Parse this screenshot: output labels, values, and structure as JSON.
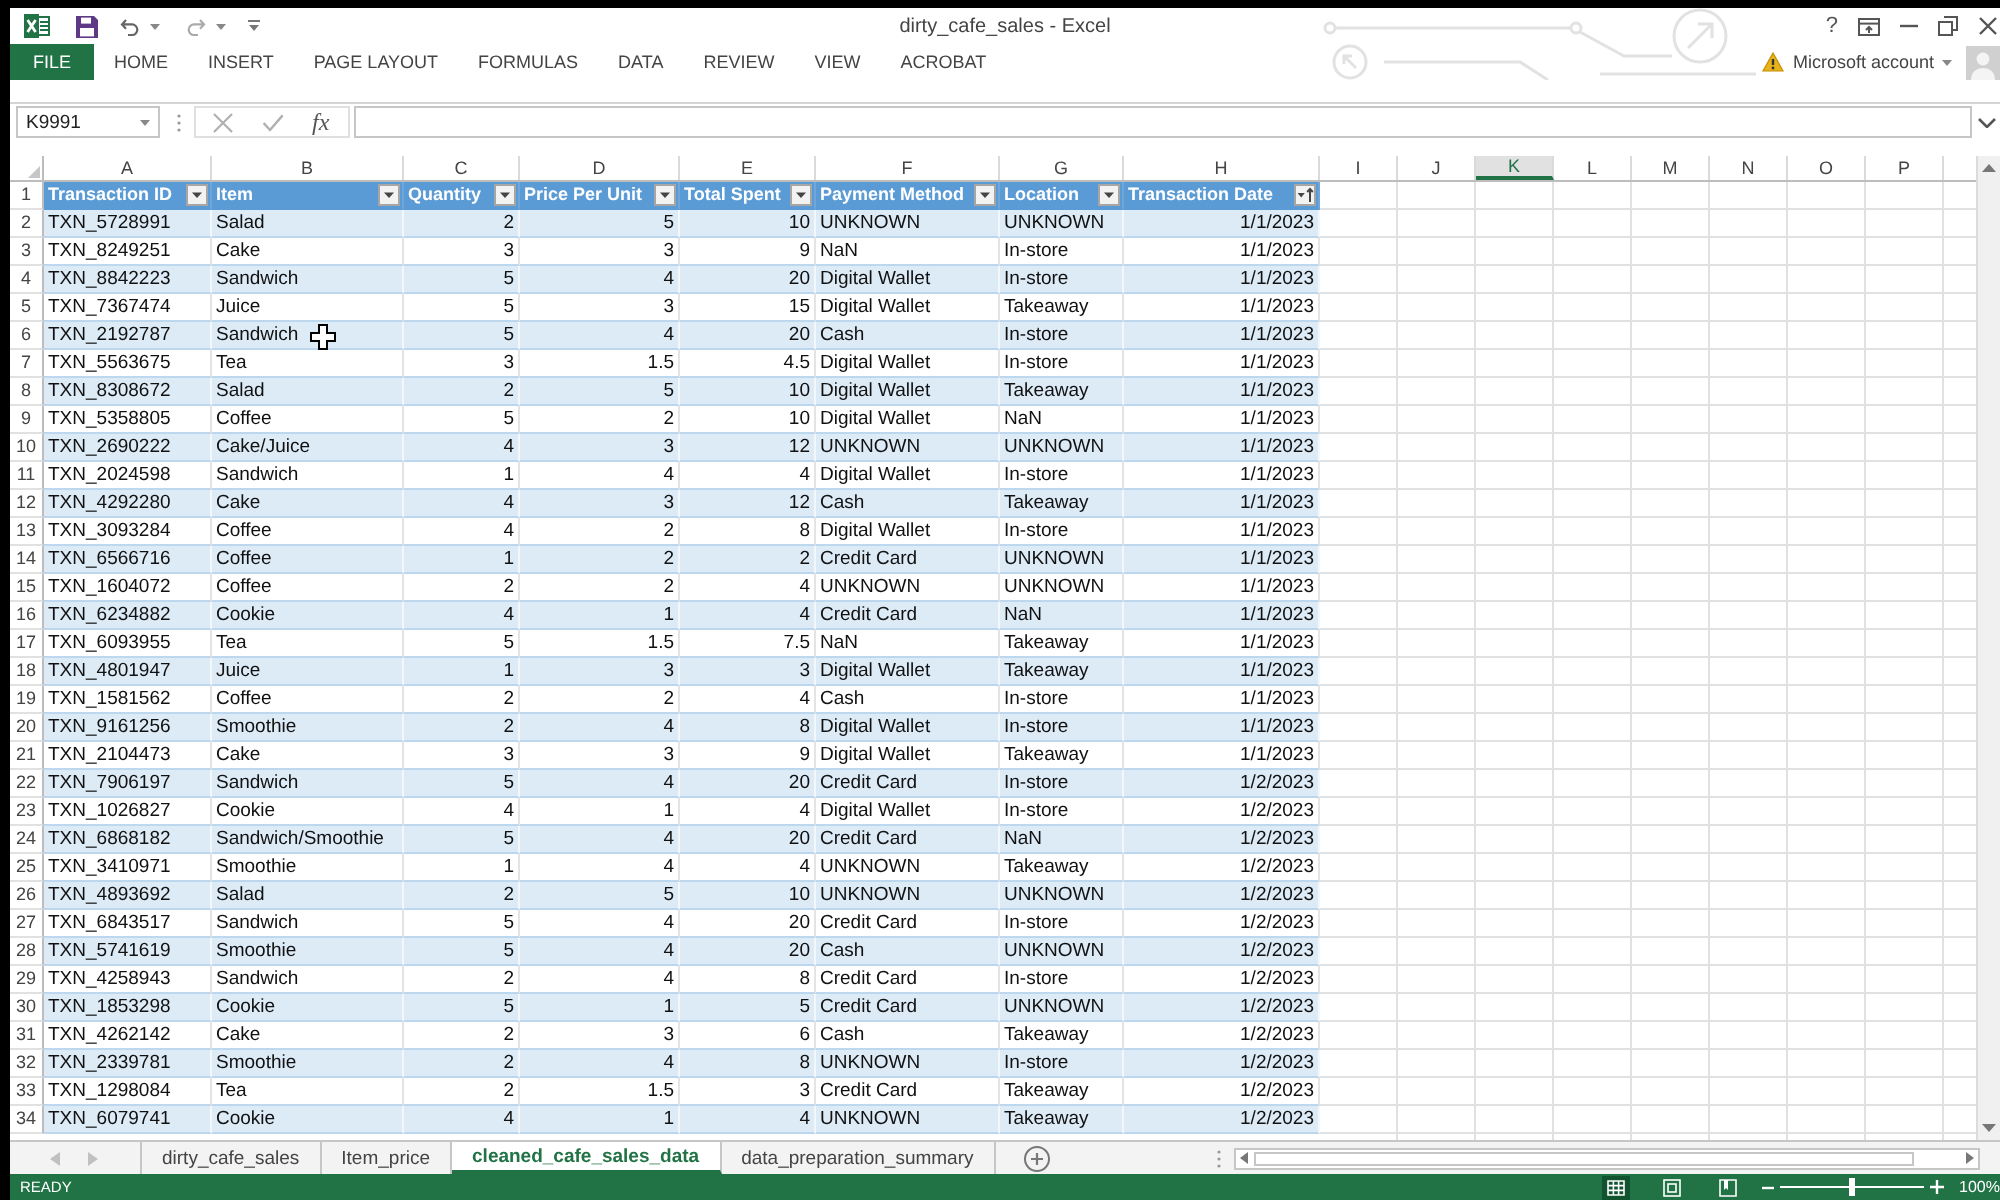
{
  "title_bar": {
    "title": "dirty_cafe_sales - Excel",
    "help": "?"
  },
  "ribbon": {
    "tabs": [
      {
        "label": "FILE",
        "kind": "backstage"
      },
      {
        "label": "HOME",
        "kind": "tab"
      },
      {
        "label": "INSERT",
        "kind": "tab"
      },
      {
        "label": "PAGE LAYOUT",
        "kind": "tab"
      },
      {
        "label": "FORMULAS",
        "kind": "tab"
      },
      {
        "label": "DATA",
        "kind": "tab"
      },
      {
        "label": "REVIEW",
        "kind": "tab"
      },
      {
        "label": "VIEW",
        "kind": "tab"
      },
      {
        "label": "ACROBAT",
        "kind": "tab"
      }
    ],
    "account": "Microsoft account"
  },
  "formula_bar": {
    "name_box": "K9991",
    "function_label": "fx"
  },
  "column_letters": [
    {
      "letter": "A",
      "selected": false
    },
    {
      "letter": "B",
      "selected": false
    },
    {
      "letter": "C",
      "selected": false
    },
    {
      "letter": "D",
      "selected": false
    },
    {
      "letter": "E",
      "selected": false
    },
    {
      "letter": "F",
      "selected": false
    },
    {
      "letter": "G",
      "selected": false
    },
    {
      "letter": "H",
      "selected": false
    },
    {
      "letter": "I",
      "selected": false
    },
    {
      "letter": "J",
      "selected": false
    },
    {
      "letter": "K",
      "selected": true
    },
    {
      "letter": "L",
      "selected": false
    },
    {
      "letter": "M",
      "selected": false
    },
    {
      "letter": "N",
      "selected": false
    },
    {
      "letter": "O",
      "selected": false
    },
    {
      "letter": "P",
      "selected": false
    }
  ],
  "table": {
    "header_row_number": "1",
    "columns": [
      {
        "name": "Transaction ID",
        "kind": "text",
        "sorted": false
      },
      {
        "name": "Item",
        "kind": "text",
        "sorted": false
      },
      {
        "name": "Quantity",
        "kind": "number",
        "sorted": false
      },
      {
        "name": "Price Per Unit",
        "kind": "number",
        "sorted": false
      },
      {
        "name": "Total Spent",
        "kind": "number",
        "sorted": false
      },
      {
        "name": "Payment Method",
        "kind": "text",
        "sorted": false
      },
      {
        "name": "Location",
        "kind": "text",
        "sorted": false
      },
      {
        "name": "Transaction Date",
        "kind": "date",
        "sorted": true
      }
    ],
    "rows": [
      {
        "number": "2",
        "cells": [
          "TXN_5728991",
          "Salad",
          "2",
          "5",
          "10",
          "UNKNOWN",
          "UNKNOWN",
          "1/1/2023"
        ]
      },
      {
        "number": "3",
        "cells": [
          "TXN_8249251",
          "Cake",
          "3",
          "3",
          "9",
          "NaN",
          "In-store",
          "1/1/2023"
        ]
      },
      {
        "number": "4",
        "cells": [
          "TXN_8842223",
          "Sandwich",
          "5",
          "4",
          "20",
          "Digital Wallet",
          "In-store",
          "1/1/2023"
        ]
      },
      {
        "number": "5",
        "cells": [
          "TXN_7367474",
          "Juice",
          "5",
          "3",
          "15",
          "Digital Wallet",
          "Takeaway",
          "1/1/2023"
        ]
      },
      {
        "number": "6",
        "cells": [
          "TXN_2192787",
          "Sandwich",
          "5",
          "4",
          "20",
          "Cash",
          "In-store",
          "1/1/2023"
        ]
      },
      {
        "number": "7",
        "cells": [
          "TXN_5563675",
          "Tea",
          "3",
          "1.5",
          "4.5",
          "Digital Wallet",
          "In-store",
          "1/1/2023"
        ]
      },
      {
        "number": "8",
        "cells": [
          "TXN_8308672",
          "Salad",
          "2",
          "5",
          "10",
          "Digital Wallet",
          "Takeaway",
          "1/1/2023"
        ]
      },
      {
        "number": "9",
        "cells": [
          "TXN_5358805",
          "Coffee",
          "5",
          "2",
          "10",
          "Digital Wallet",
          "NaN",
          "1/1/2023"
        ]
      },
      {
        "number": "10",
        "cells": [
          "TXN_2690222",
          "Cake/Juice",
          "4",
          "3",
          "12",
          "UNKNOWN",
          "UNKNOWN",
          "1/1/2023"
        ]
      },
      {
        "number": "11",
        "cells": [
          "TXN_2024598",
          "Sandwich",
          "1",
          "4",
          "4",
          "Digital Wallet",
          "In-store",
          "1/1/2023"
        ]
      },
      {
        "number": "12",
        "cells": [
          "TXN_4292280",
          "Cake",
          "4",
          "3",
          "12",
          "Cash",
          "Takeaway",
          "1/1/2023"
        ]
      },
      {
        "number": "13",
        "cells": [
          "TXN_3093284",
          "Coffee",
          "4",
          "2",
          "8",
          "Digital Wallet",
          "In-store",
          "1/1/2023"
        ]
      },
      {
        "number": "14",
        "cells": [
          "TXN_6566716",
          "Coffee",
          "1",
          "2",
          "2",
          "Credit Card",
          "UNKNOWN",
          "1/1/2023"
        ]
      },
      {
        "number": "15",
        "cells": [
          "TXN_1604072",
          "Coffee",
          "2",
          "2",
          "4",
          "UNKNOWN",
          "UNKNOWN",
          "1/1/2023"
        ]
      },
      {
        "number": "16",
        "cells": [
          "TXN_6234882",
          "Cookie",
          "4",
          "1",
          "4",
          "Credit Card",
          "NaN",
          "1/1/2023"
        ]
      },
      {
        "number": "17",
        "cells": [
          "TXN_6093955",
          "Tea",
          "5",
          "1.5",
          "7.5",
          "NaN",
          "Takeaway",
          "1/1/2023"
        ]
      },
      {
        "number": "18",
        "cells": [
          "TXN_4801947",
          "Juice",
          "1",
          "3",
          "3",
          "Digital Wallet",
          "Takeaway",
          "1/1/2023"
        ]
      },
      {
        "number": "19",
        "cells": [
          "TXN_1581562",
          "Coffee",
          "2",
          "2",
          "4",
          "Cash",
          "In-store",
          "1/1/2023"
        ]
      },
      {
        "number": "20",
        "cells": [
          "TXN_9161256",
          "Smoothie",
          "2",
          "4",
          "8",
          "Digital Wallet",
          "In-store",
          "1/1/2023"
        ]
      },
      {
        "number": "21",
        "cells": [
          "TXN_2104473",
          "Cake",
          "3",
          "3",
          "9",
          "Digital Wallet",
          "Takeaway",
          "1/1/2023"
        ]
      },
      {
        "number": "22",
        "cells": [
          "TXN_7906197",
          "Sandwich",
          "5",
          "4",
          "20",
          "Credit Card",
          "In-store",
          "1/2/2023"
        ]
      },
      {
        "number": "23",
        "cells": [
          "TXN_1026827",
          "Cookie",
          "4",
          "1",
          "4",
          "Digital Wallet",
          "In-store",
          "1/2/2023"
        ]
      },
      {
        "number": "24",
        "cells": [
          "TXN_6868182",
          "Sandwich/Smoothie",
          "5",
          "4",
          "20",
          "Credit Card",
          "NaN",
          "1/2/2023"
        ]
      },
      {
        "number": "25",
        "cells": [
          "TXN_3410971",
          "Smoothie",
          "1",
          "4",
          "4",
          "UNKNOWN",
          "Takeaway",
          "1/2/2023"
        ]
      },
      {
        "number": "26",
        "cells": [
          "TXN_4893692",
          "Salad",
          "2",
          "5",
          "10",
          "UNKNOWN",
          "UNKNOWN",
          "1/2/2023"
        ]
      },
      {
        "number": "27",
        "cells": [
          "TXN_6843517",
          "Sandwich",
          "5",
          "4",
          "20",
          "Credit Card",
          "In-store",
          "1/2/2023"
        ]
      },
      {
        "number": "28",
        "cells": [
          "TXN_5741619",
          "Smoothie",
          "5",
          "4",
          "20",
          "Cash",
          "UNKNOWN",
          "1/2/2023"
        ]
      },
      {
        "number": "29",
        "cells": [
          "TXN_4258943",
          "Sandwich",
          "2",
          "4",
          "8",
          "Credit Card",
          "In-store",
          "1/2/2023"
        ]
      },
      {
        "number": "30",
        "cells": [
          "TXN_1853298",
          "Cookie",
          "5",
          "1",
          "5",
          "Credit Card",
          "UNKNOWN",
          "1/2/2023"
        ]
      },
      {
        "number": "31",
        "cells": [
          "TXN_4262142",
          "Cake",
          "2",
          "3",
          "6",
          "Cash",
          "Takeaway",
          "1/2/2023"
        ]
      },
      {
        "number": "32",
        "cells": [
          "TXN_2339781",
          "Smoothie",
          "2",
          "4",
          "8",
          "UNKNOWN",
          "In-store",
          "1/2/2023"
        ]
      },
      {
        "number": "33",
        "cells": [
          "TXN_1298084",
          "Tea",
          "2",
          "1.5",
          "3",
          "Credit Card",
          "Takeaway",
          "1/2/2023"
        ]
      },
      {
        "number": "34",
        "cells": [
          "TXN_6079741",
          "Cookie",
          "4",
          "1",
          "4",
          "UNKNOWN",
          "Takeaway",
          "1/2/2023"
        ]
      }
    ]
  },
  "sheet_tabs": [
    {
      "label": "dirty_cafe_sales",
      "selected": false
    },
    {
      "label": "Item_price",
      "selected": false
    },
    {
      "label": "cleaned_cafe_sales_data",
      "selected": true
    },
    {
      "label": "data_preparation_summary",
      "selected": false
    }
  ],
  "status_bar": {
    "status": "READY",
    "views": [
      {
        "kind": "normal",
        "selected": true
      },
      {
        "kind": "page_layout",
        "selected": false
      },
      {
        "kind": "page_break",
        "selected": false
      }
    ],
    "zoom": {
      "level": 0.5,
      "reading": "100%"
    }
  }
}
